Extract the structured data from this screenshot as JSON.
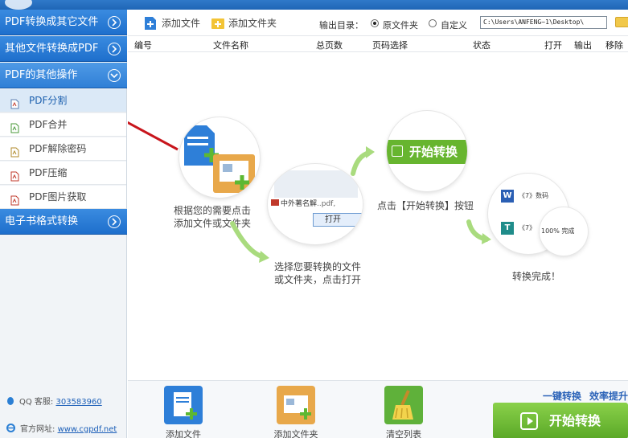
{
  "sidebar": {
    "sections": [
      {
        "label": "PDF转换成其它文件"
      },
      {
        "label": "其他文件转换成PDF"
      },
      {
        "label": "PDF的其他操作"
      },
      {
        "label": "电子书格式转换"
      }
    ],
    "items": [
      {
        "label": "PDF分割"
      },
      {
        "label": "PDF合并"
      },
      {
        "label": "PDF解除密码"
      },
      {
        "label": "PDF压缩"
      },
      {
        "label": "PDF图片获取"
      }
    ],
    "footer": {
      "qq_label": "QQ 客服:",
      "qq_number": "303583960",
      "site_label": "官方网址:",
      "site_url": "www.cgpdf.net"
    }
  },
  "toolbar": {
    "add_file": "添加文件",
    "add_folder": "添加文件夹",
    "output_label": "输出目录：",
    "radio_original": "原文件夹",
    "radio_custom": "自定义",
    "output_path": "C:\\Users\\ANFENG~1\\Desktop\\"
  },
  "table": {
    "columns": [
      "编号",
      "文件名称",
      "总页数",
      "页码选择",
      "状态",
      "打开",
      "输出",
      "移除"
    ]
  },
  "guide": {
    "step1": [
      "根据您的需要点击",
      "添加文件或文件夹"
    ],
    "step2": [
      "选择您要转换的文件",
      "或文件夹，点击打开"
    ],
    "step3": "点击【开始转换】按钮",
    "step4": "转换完成！",
    "bubble2_file": "中外著名解",
    "bubble2_ext": "..pdf,",
    "bubble2_open": "打开",
    "bubble3_btn": "开始转换",
    "bubble4_doc1": "《7》数码",
    "bubble4_doc2": "《7》",
    "bubble4_progress": "100% 完成"
  },
  "bottom": {
    "add_file": "添加文件",
    "add_folder": "添加文件夹",
    "clear_list": "清空列表",
    "slogan1": "一键转换",
    "slogan2": "效率提升",
    "start": "开始转换"
  },
  "colors": {
    "accent_blue": "#1e6fcc",
    "accent_green": "#5aa827",
    "arrow_red": "#c8151c"
  }
}
